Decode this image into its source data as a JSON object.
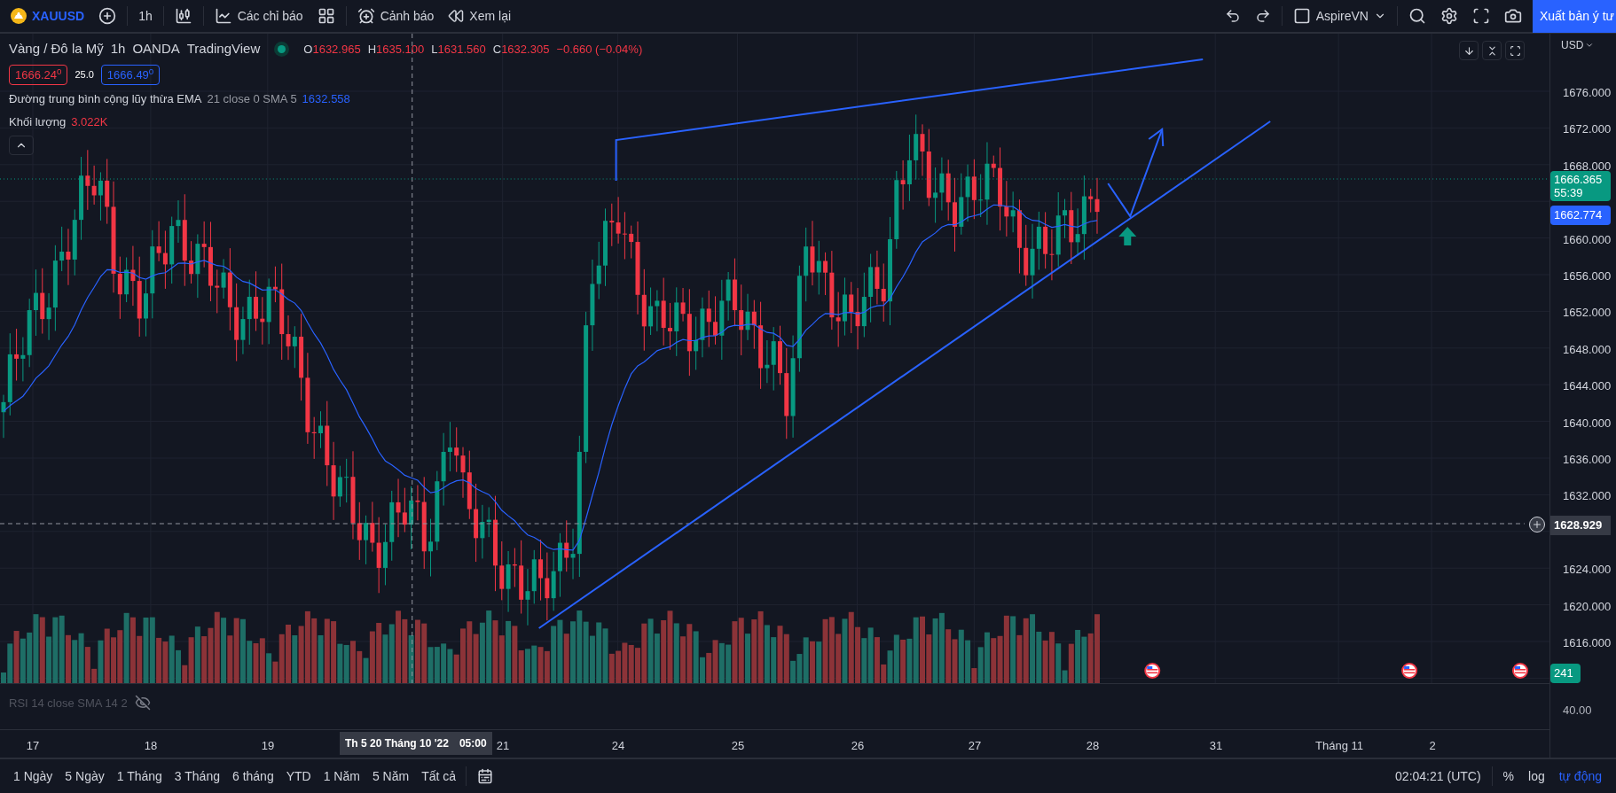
{
  "toolbar": {
    "symbol": "XAUUSD",
    "interval": "1h",
    "indicators_label": "Các chỉ báo",
    "alerts_label": "Cảnh báo",
    "replay_label": "Xem lại",
    "layout_name": "AspireVN",
    "publish_label": "Xuất bản ý tư"
  },
  "legend": {
    "title": [
      "Vàng / Đô la Mỹ",
      "1h",
      "OANDA",
      "TradingView"
    ],
    "market_open": true,
    "ohlc": [
      {
        "key": "O",
        "value": "1632.965"
      },
      {
        "key": "H",
        "value": "1635.100"
      },
      {
        "key": "L",
        "value": "1631.560"
      },
      {
        "key": "C",
        "value": "1632.305"
      }
    ],
    "change": "−0.660 (−0.04%)",
    "bid": "1666.24$^{0}$",
    "spread": "25.0",
    "ask": "1666.49$^{0}$",
    "indicators": [
      {
        "name": "Đường trung bình cộng lũy thừa EMA",
        "params": "21 close 0 SMA 5",
        "value": "1632.558",
        "color": "#2962ff"
      },
      {
        "name": "Khối lượng",
        "value": "3.022K",
        "color": "#f23645"
      }
    ]
  },
  "price_axis": {
    "currency": "USD",
    "ticks": [
      "1676.000",
      "1672.000",
      "1668.000",
      "1660.000",
      "1656.000",
      "1652.000",
      "1648.000",
      "1644.000",
      "1640.000",
      "1636.000",
      "1632.000",
      "1624.000",
      "1620.000",
      "1616.000"
    ],
    "last_price": "1666.365",
    "countdown": "55:39",
    "ema_tag": "1662.774",
    "crosshair_price": "1628.929",
    "volume_tag": "241"
  },
  "rsi": {
    "label": "RSI 14 close SMA 14 2",
    "visible": false,
    "tick": "40.00"
  },
  "time_axis": {
    "ticks": [
      "17",
      "18",
      "19",
      "21",
      "24",
      "25",
      "26",
      "27",
      "28",
      "31",
      "Tháng 11",
      "2"
    ],
    "crosshair_label": "Th 5 20 Tháng 10 '22",
    "crosshair_time": "05:00"
  },
  "ranges": [
    "1 Ngày",
    "5 Ngày",
    "1 Tháng",
    "3 Tháng",
    "6 tháng",
    "YTD",
    "1 Năm",
    "5 Năm",
    "Tất cả"
  ],
  "status": {
    "time": "02:04:21 (UTC)",
    "percent": "%",
    "log": "log",
    "auto": "tự động",
    "auto_on": true
  }
}
